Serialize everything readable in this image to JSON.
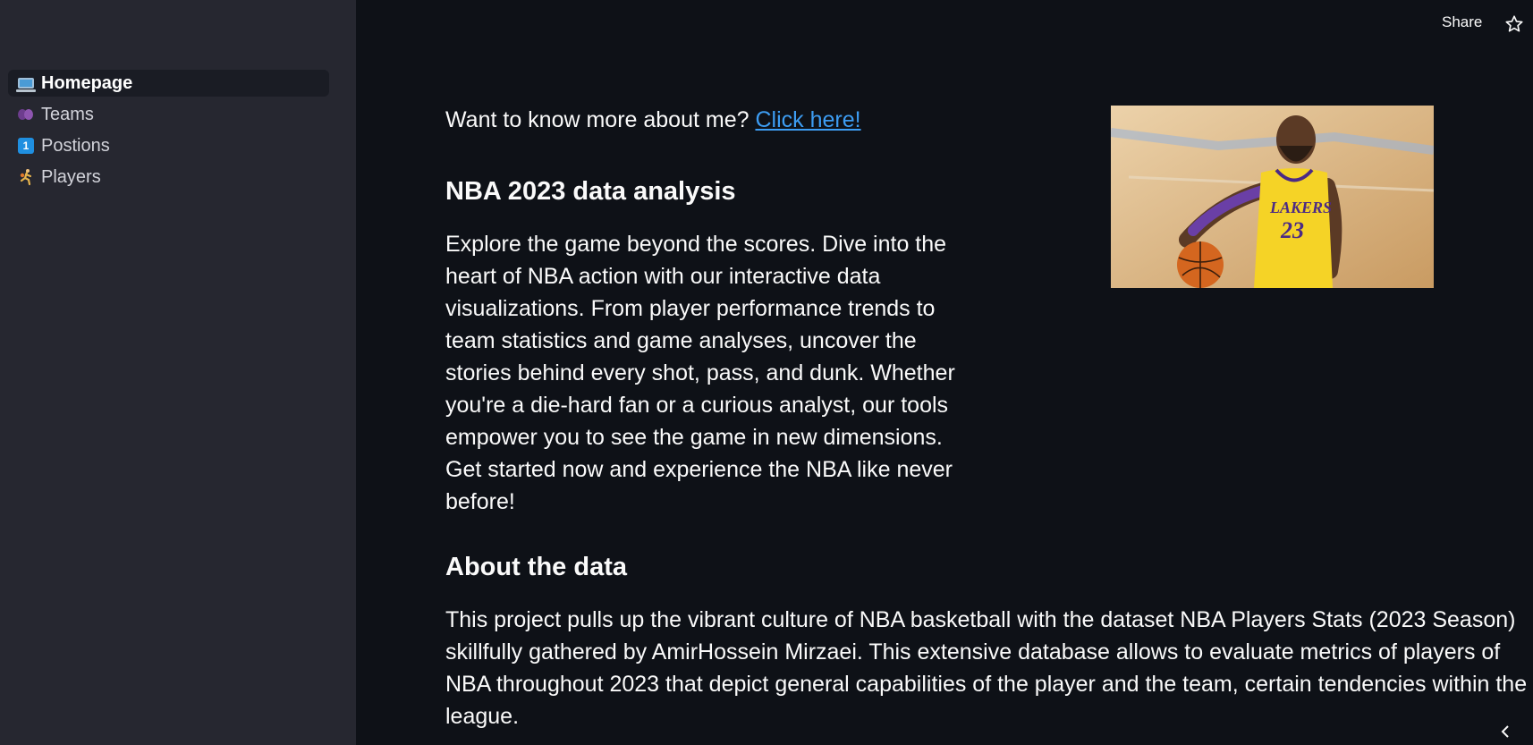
{
  "sidebar": {
    "items": [
      {
        "icon": "laptop-icon",
        "label": "Homepage",
        "active": true
      },
      {
        "icon": "hearts-icon",
        "label": "Teams",
        "active": false
      },
      {
        "icon": "keycap-one-icon",
        "label": "Postions",
        "active": false
      },
      {
        "icon": "basketball-player-icon",
        "label": "Players",
        "active": false
      }
    ]
  },
  "header": {
    "share_label": "Share",
    "star_icon": "star-icon"
  },
  "main": {
    "intro_text": "Want to know more about me? ",
    "intro_link": "Click here!",
    "heading1": "NBA 2023 data analysis",
    "paragraph1": "Explore the game beyond the scores. Dive into the heart of NBA action with our interactive data visualizations. From player performance trends to team statistics and game analyses, uncover the stories behind every shot, pass, and dunk. Whether you're a die-hard fan or a curious analyst, our tools empower you to see the game in new dimensions. Get started now and experience the NBA like never before!",
    "heading2": "About the data",
    "paragraph2": "This project pulls up the vibrant culture of NBA basketball with the dataset NBA Players Stats (2023 Season) skillfully gathered by AmirHossein Mirzaei. This extensive database allows to evaluate metrics of players of NBA throughout 2023 that depict general capabilities of the player and the team, certain tendencies within the league.",
    "photo": {
      "jersey_text": "LAKERS",
      "jersey_number": "23"
    }
  },
  "colors": {
    "background": "#0e1117",
    "sidebar": "#262730",
    "link": "#3d9df3",
    "text": "#fafafa"
  }
}
